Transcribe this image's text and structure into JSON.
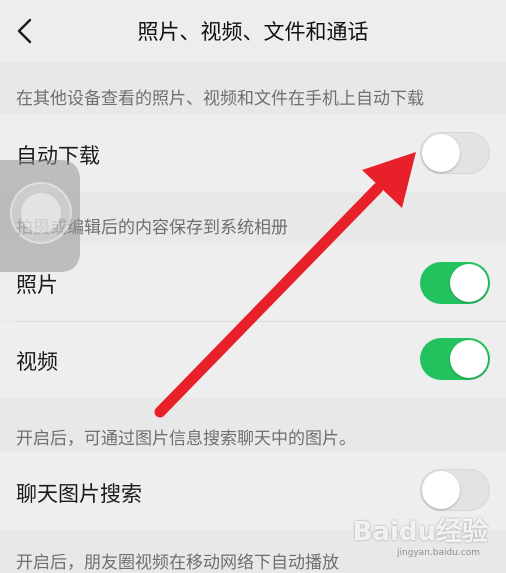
{
  "header": {
    "title": "照片、视频、文件和通话"
  },
  "sections": {
    "auto_download_note": "在其他设备查看的照片、视频和文件在手机上自动下载",
    "save_album_note": "拍摄或编辑后的内容保存到系统相册",
    "image_search_note": "开启后，可通过图片信息搜索聊天中的图片。",
    "bottom_note": "开启后，朋友圈视频在移动网络下自动播放"
  },
  "rows": {
    "auto_download": {
      "label": "自动下载",
      "enabled": false
    },
    "photos": {
      "label": "照片",
      "enabled": true
    },
    "videos": {
      "label": "视频",
      "enabled": true
    },
    "chat_image_search": {
      "label": "聊天图片搜索",
      "enabled": false
    }
  },
  "colors": {
    "toggle_on": "#22c35e",
    "annotation_arrow": "#e8202a"
  },
  "watermark": {
    "brand": "Baidu经验",
    "url": "jingyan.baidu.com"
  }
}
